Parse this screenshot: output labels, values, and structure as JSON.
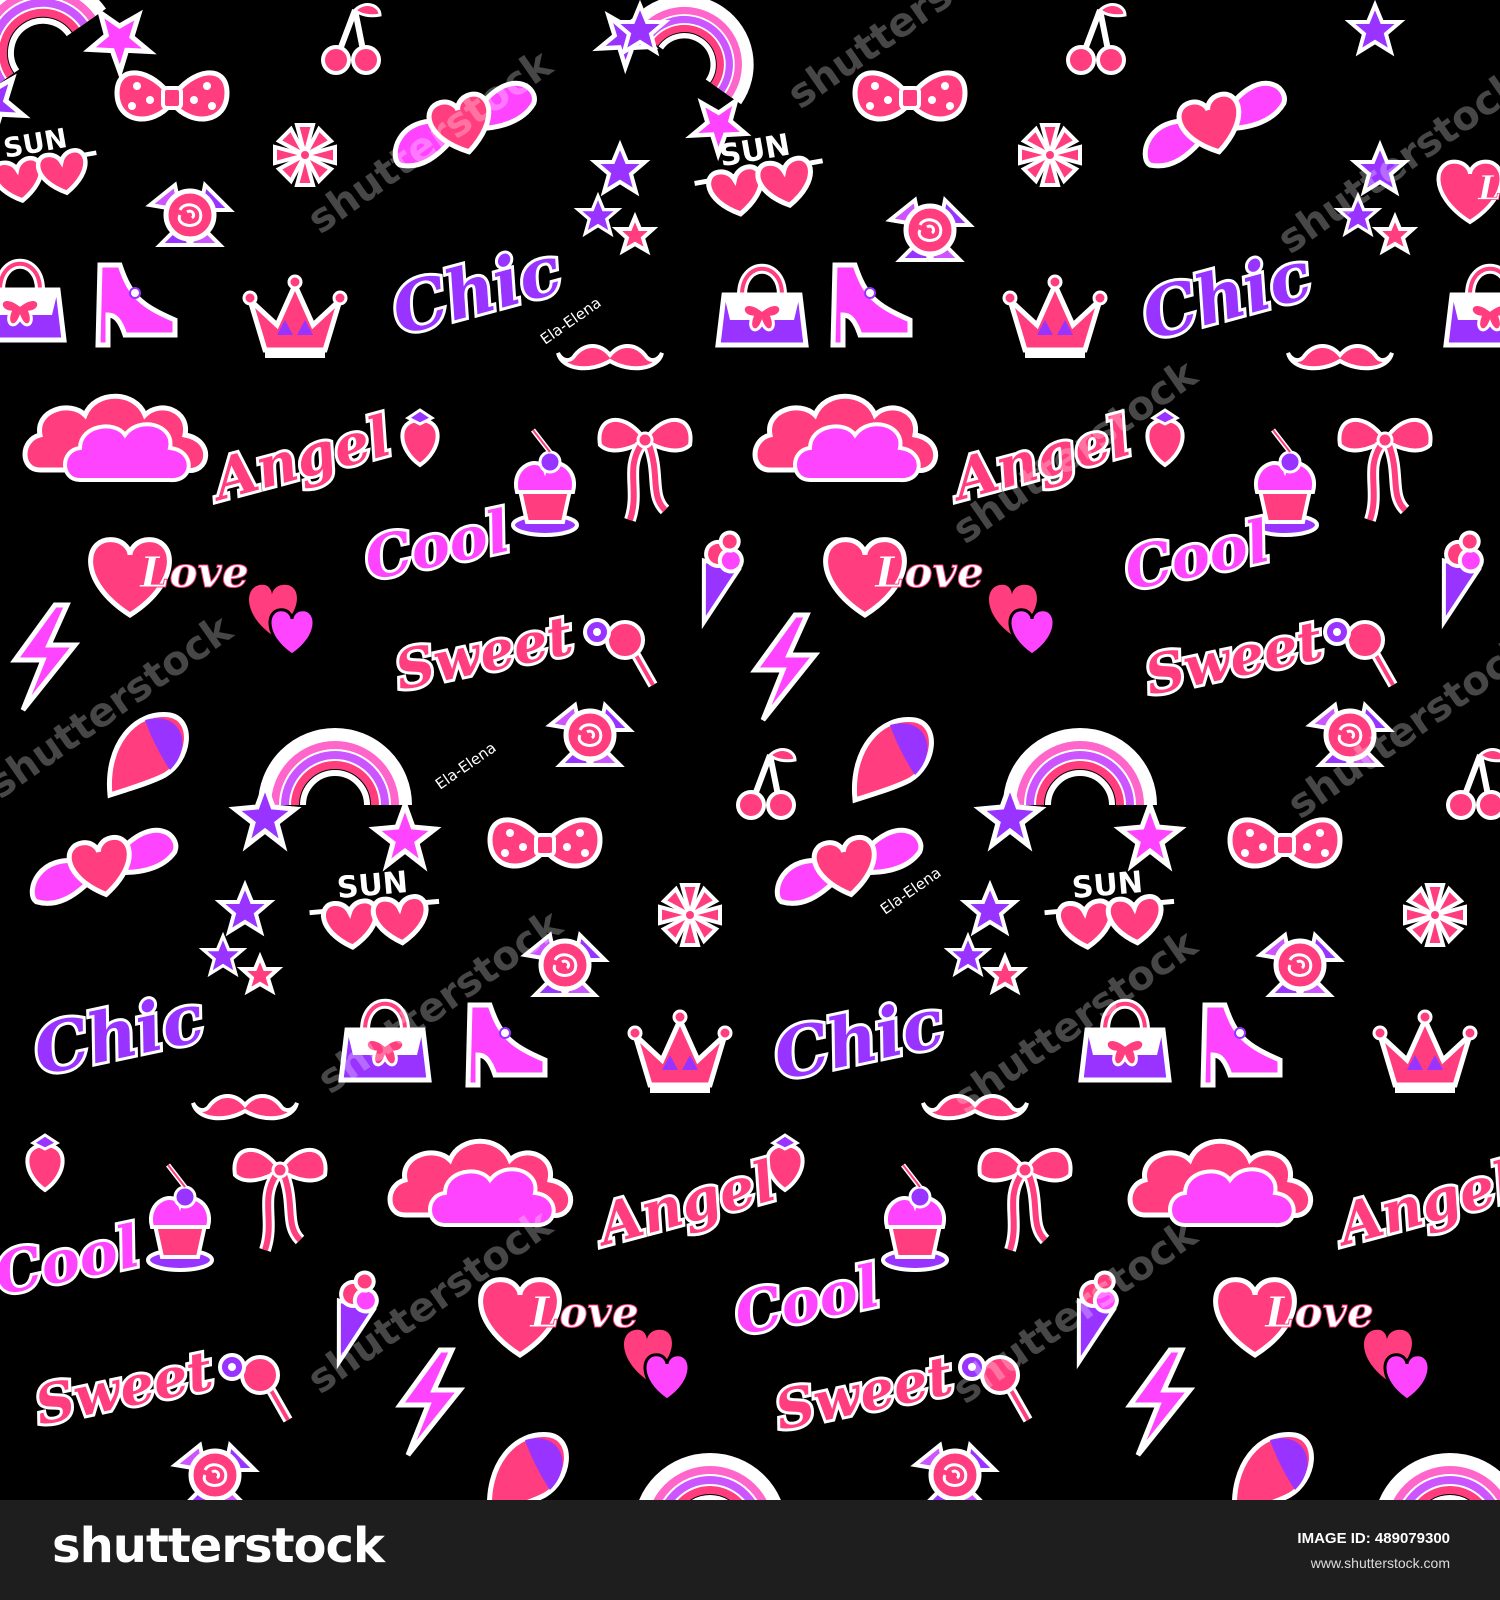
{
  "pattern": {
    "words": {
      "chic": "Chic",
      "angel": "Angel",
      "cool": "Cool",
      "love": "Love",
      "sweet": "Sweet",
      "sun": "SUN"
    },
    "artist_signature": "Ela-Elena",
    "watermark_text": "shutterstock",
    "colors": {
      "background": "#000000",
      "pink": "#ff3d7f",
      "magenta": "#ff44ff",
      "purple": "#9933ff",
      "outline": "#ffffff"
    },
    "icons": [
      "rainbow-star-icon",
      "bow-icon",
      "winged-heart-icon",
      "cherry-icon",
      "star-icon",
      "flower-icon",
      "rose-icon",
      "heart-glasses-icon",
      "handbag-icon",
      "high-heel-shoe-icon",
      "crown-icon",
      "moustache-icon",
      "cloud-icon",
      "strawberry-icon",
      "cupcake-icon",
      "ribbon-bow-icon",
      "heart-icon",
      "double-heart-icon",
      "lightning-icon",
      "ice-cream-icon",
      "lollipop-icon",
      "wing-icon"
    ]
  },
  "footer": {
    "logo": "shutterstock",
    "image_id_label": "IMAGE ID: 489079300",
    "site": "www.shutterstock.com"
  }
}
